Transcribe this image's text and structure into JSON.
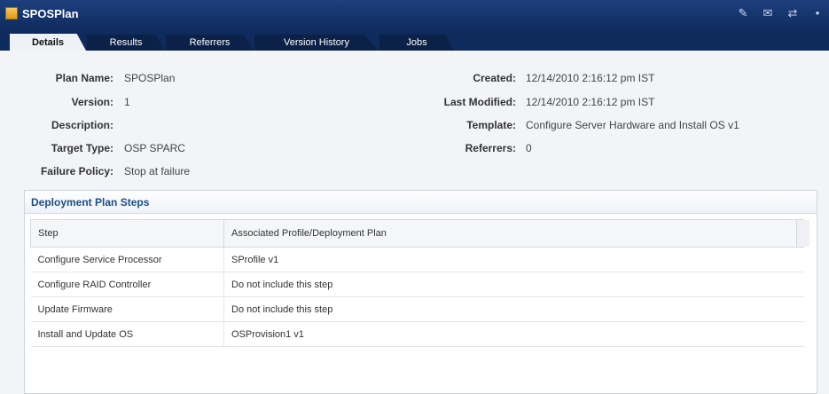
{
  "header": {
    "title": "SPOSPlan",
    "icons": [
      "edit-plan-icon",
      "email-icon",
      "transfer-icon",
      "more-icon"
    ]
  },
  "tabs": [
    {
      "label": "Details",
      "active": true
    },
    {
      "label": "Results",
      "active": false
    },
    {
      "label": "Referrers",
      "active": false
    },
    {
      "label": "Version History",
      "active": false
    },
    {
      "label": "Jobs",
      "active": false
    }
  ],
  "details": {
    "plan_name_label": "Plan Name:",
    "plan_name": "SPOSPlan",
    "version_label": "Version:",
    "version": "1",
    "description_label": "Description:",
    "description": "",
    "target_type_label": "Target Type:",
    "target_type": "OSP SPARC",
    "failure_policy_label": "Failure Policy:",
    "failure_policy": "Stop at failure",
    "created_label": "Created:",
    "created": "12/14/2010 2:16:12 pm IST",
    "last_modified_label": "Last Modified:",
    "last_modified": "12/14/2010 2:16:12 pm IST",
    "template_label": "Template:",
    "template": "Configure Server Hardware and Install OS v1",
    "referrers_label": "Referrers:",
    "referrers": "0"
  },
  "steps_panel": {
    "title": "Deployment Plan Steps",
    "columns": [
      "Step",
      "Associated Profile/Deployment Plan"
    ],
    "rows": [
      [
        "Configure Service Processor",
        "SProfile v1"
      ],
      [
        "Configure RAID Controller",
        "Do not include this step"
      ],
      [
        "Update Firmware",
        "Do not include this step"
      ],
      [
        "Install and Update OS",
        "OSProvision1 v1"
      ]
    ]
  },
  "colors": {
    "header_bg": "#0f2a5c",
    "accent": "#1d4f86"
  }
}
